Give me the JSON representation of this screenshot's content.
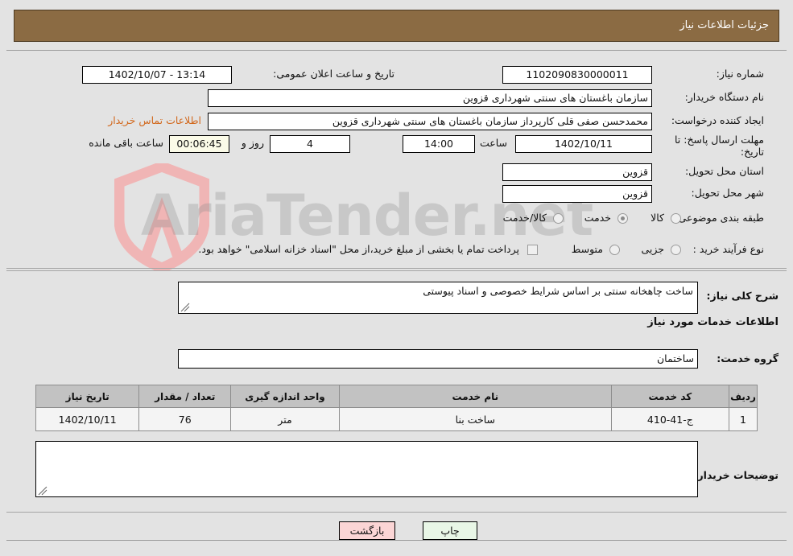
{
  "header": {
    "title": "جزئیات اطلاعات نیاز"
  },
  "watermark": {
    "text": "AriaTender.net",
    "shield_color": "#f0b5b5"
  },
  "form": {
    "need_number": {
      "label": "شماره نیاز:",
      "value": "1102090830000011"
    },
    "announce": {
      "label": "تاریخ و ساعت اعلان عمومی:",
      "value": "13:14 - 1402/10/07"
    },
    "buyer_org": {
      "label": "نام دستگاه خریدار:",
      "value": "سازمان باغستان های سنتی شهرداری قزوین"
    },
    "requester": {
      "label": "ایجاد کننده درخواست:",
      "value": "محمدحسن صفی قلی کارپرداز سازمان باغستان های سنتی شهرداری قزوین"
    },
    "contact_link": {
      "label": "اطلاعات تماس خریدار"
    },
    "deadline": {
      "label": "مهلت ارسال پاسخ: تا تاریخ:",
      "date": "1402/10/11",
      "time_label": "ساعت",
      "time": "14:00",
      "days": "4",
      "days_label": "روز و",
      "countdown": "00:06:45",
      "remaining_label": "ساعت باقی مانده"
    },
    "province": {
      "label": "استان محل تحویل:",
      "value": "قزوین"
    },
    "city": {
      "label": "شهر محل تحویل:",
      "value": "قزوین"
    },
    "category": {
      "label": "طبقه بندی موضوعی:",
      "options": [
        "کالا",
        "خدمت",
        "کالا/خدمت"
      ],
      "selected": "خدمت"
    },
    "process_type": {
      "label": "نوع فرآیند خرید :",
      "options": [
        "جزیی",
        "متوسط"
      ],
      "selected": "",
      "treasury_checkbox_label": "پرداخت تمام یا بخشی از مبلغ خرید،از محل \"اسناد خزانه اسلامی\" خواهد بود.",
      "treasury_checked": false
    },
    "general_description": {
      "label": "شرح کلی نیاز:",
      "value": "ساخت چاهخانه سنتی بر اساس شرایط خصوصی و اسناد پیوستی"
    },
    "services_heading": "اطلاعات خدمات مورد نیاز",
    "service_group": {
      "label": "گروه خدمت:",
      "value": "ساختمان"
    },
    "buyer_notes": {
      "label": "توضیحات خریدار:",
      "value": ""
    }
  },
  "table": {
    "columns": [
      "ردیف",
      "کد خدمت",
      "نام خدمت",
      "واحد اندازه گیری",
      "تعداد / مقدار",
      "تاریخ نیاز"
    ],
    "rows": [
      {
        "row": "1",
        "code": "ج-41-410",
        "name": "ساخت بنا",
        "unit": "متر",
        "quantity": "76",
        "need_date": "1402/10/11"
      }
    ]
  },
  "buttons": {
    "print": "چاپ",
    "back": "بازگشت"
  }
}
